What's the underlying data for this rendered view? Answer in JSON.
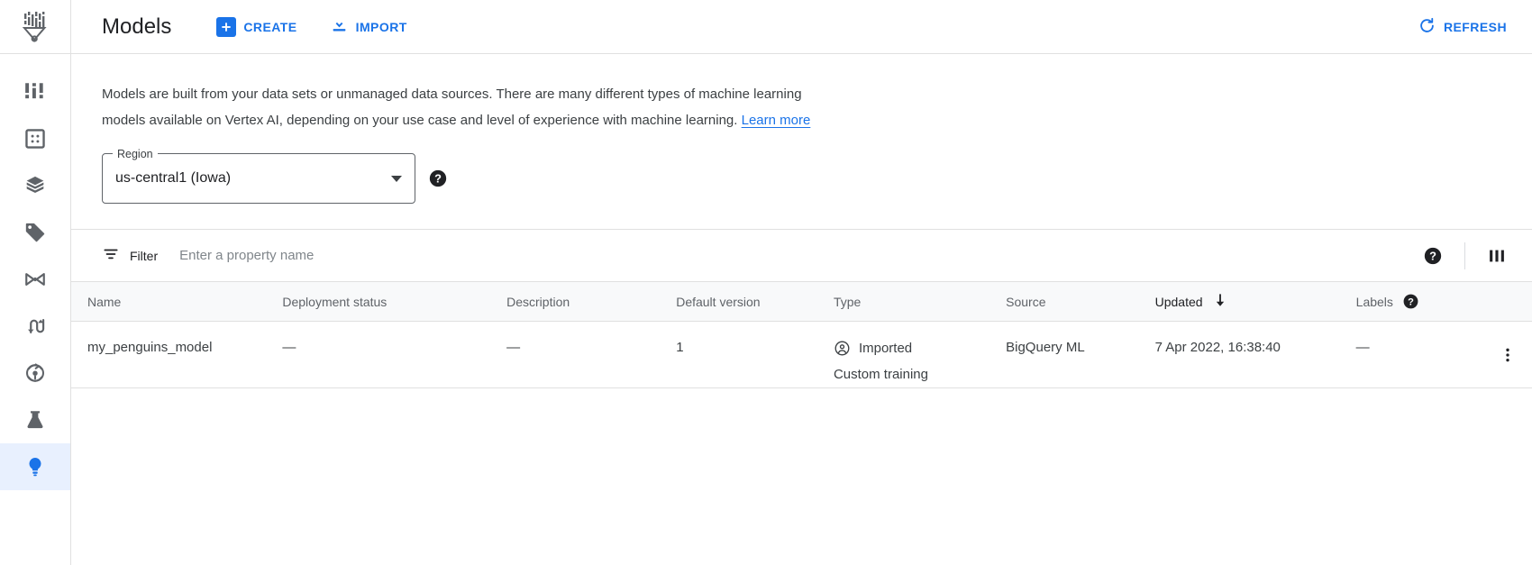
{
  "rail": {
    "logo_icon": "vertex-ai-logo-icon",
    "items": [
      {
        "icon": "dashboard-icon",
        "name": "sidebar-item-dashboard",
        "active": false
      },
      {
        "icon": "feature-store-icon",
        "name": "sidebar-item-feature-store",
        "active": false
      },
      {
        "icon": "datasets-icon",
        "name": "sidebar-item-datasets",
        "active": false
      },
      {
        "icon": "labeling-tasks-icon",
        "name": "sidebar-item-labeling-tasks",
        "active": false
      },
      {
        "icon": "notebooks-icon",
        "name": "sidebar-item-notebooks",
        "active": false
      },
      {
        "icon": "pipelines-icon",
        "name": "sidebar-item-pipelines",
        "active": false
      },
      {
        "icon": "training-icon",
        "name": "sidebar-item-training",
        "active": false
      },
      {
        "icon": "experiments-icon",
        "name": "sidebar-item-experiments",
        "active": false
      },
      {
        "icon": "models-icon",
        "name": "sidebar-item-models",
        "active": true
      }
    ]
  },
  "topbar": {
    "title": "Models",
    "create_label": "CREATE",
    "create_icon": "plus-icon",
    "import_label": "IMPORT",
    "import_icon": "download-icon",
    "refresh_label": "REFRESH",
    "refresh_icon": "refresh-icon"
  },
  "intro": {
    "text_before_link": "Models are built from your data sets or unmanaged data sources. There are many different types of machine learning models available on Vertex AI, depending on your use case and level of experience with machine learning. ",
    "link_label": "Learn more"
  },
  "region": {
    "label": "Region",
    "value": "us-central1 (Iowa)",
    "caret_icon": "chevron-down-icon",
    "help_icon": "help-icon"
  },
  "filter": {
    "label": "Filter",
    "filter_icon": "filter-list-icon",
    "placeholder": "Enter a property name",
    "value": "",
    "help_icon": "help-icon",
    "columns_icon": "column-settings-icon"
  },
  "table": {
    "columns": [
      {
        "label": "Name",
        "key": "name",
        "sorted": false
      },
      {
        "label": "Deployment status",
        "key": "deployment_status",
        "sorted": false
      },
      {
        "label": "Description",
        "key": "description",
        "sorted": false
      },
      {
        "label": "Default version",
        "key": "default_version",
        "sorted": false
      },
      {
        "label": "Type",
        "key": "type",
        "sorted": false
      },
      {
        "label": "Source",
        "key": "source",
        "sorted": false
      },
      {
        "label": "Updated",
        "key": "updated",
        "sorted": true,
        "sort_icon": "arrow-down-icon"
      },
      {
        "label": "Labels",
        "key": "labels",
        "sorted": false,
        "help_icon": "help-icon"
      }
    ],
    "rows": [
      {
        "name": "my_penguins_model",
        "deployment_status": "—",
        "description": "—",
        "default_version": "1",
        "type_icon": "imported-model-icon",
        "type_line1": "Imported",
        "type_line2": "Custom training",
        "source": "BigQuery ML",
        "updated": "7 Apr 2022, 16:38:40",
        "labels": "—",
        "row_menu_icon": "more-vert-icon"
      }
    ]
  },
  "colors": {
    "accent": "#1a73e8",
    "active_bg": "#e8f0fe",
    "text_primary": "#202124",
    "text_secondary": "#5f6368",
    "border": "#e0e0e0",
    "header_bg": "#f8f9fa"
  }
}
